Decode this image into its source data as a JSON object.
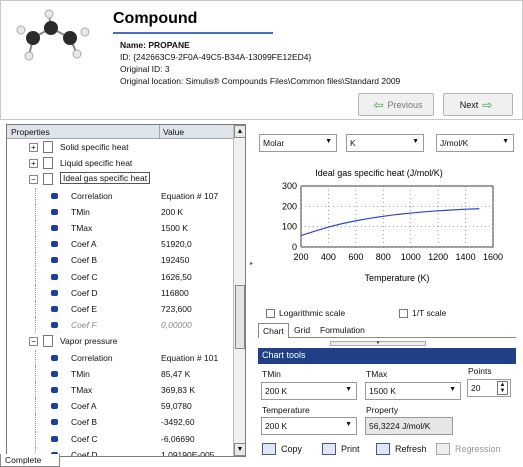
{
  "header": {
    "title": "Compound",
    "name_line": "Name: PROPANE",
    "id_line": "ID: {242663C9-2F0A-49C5-B34A-13099FE12ED4}",
    "original_id_line": "Original ID: 3",
    "location_line": "Original location: Simulis® Compounds Files\\Common files\\Standard 2009",
    "previous_label": "Previous",
    "next_label": "Next"
  },
  "tree": {
    "col_properties": "Properties",
    "col_value": "Value",
    "rows": [
      {
        "label": "Solid specific heat",
        "value": "",
        "kind": "group",
        "expanded": false
      },
      {
        "label": "Liquid specific heat",
        "value": "",
        "kind": "group",
        "expanded": false
      },
      {
        "label": "Ideal gas specific heat",
        "value": "",
        "kind": "group",
        "expanded": true,
        "highlight": true
      },
      {
        "label": "Correlation",
        "value": "Equation # 107",
        "kind": "leaf"
      },
      {
        "label": "TMin",
        "value": "200 K",
        "kind": "leaf"
      },
      {
        "label": "TMax",
        "value": "1500 K",
        "kind": "leaf"
      },
      {
        "label": "Coef A",
        "value": "51920,0",
        "kind": "leaf"
      },
      {
        "label": "Coef B",
        "value": "192450",
        "kind": "leaf"
      },
      {
        "label": "Coef C",
        "value": "1626,50",
        "kind": "leaf"
      },
      {
        "label": "Coef D",
        "value": "116800",
        "kind": "leaf"
      },
      {
        "label": "Coef E",
        "value": "723,600",
        "kind": "leaf"
      },
      {
        "label": "Coef F",
        "value": "0,00000",
        "kind": "leaf",
        "muted": true
      },
      {
        "label": "Vapor pressure",
        "value": "",
        "kind": "group",
        "expanded": true
      },
      {
        "label": "Correlation",
        "value": "Equation # 101",
        "kind": "leaf"
      },
      {
        "label": "TMin",
        "value": "85,47 K",
        "kind": "leaf"
      },
      {
        "label": "TMax",
        "value": "369,83 K",
        "kind": "leaf"
      },
      {
        "label": "Coef A",
        "value": "59,0780",
        "kind": "leaf"
      },
      {
        "label": "Coef B",
        "value": "-3492,60",
        "kind": "leaf"
      },
      {
        "label": "Coef C",
        "value": "-6,06690",
        "kind": "leaf"
      },
      {
        "label": "Coef D",
        "value": "1,09190E-005",
        "kind": "leaf"
      }
    ]
  },
  "status_tab": "Complete",
  "units": {
    "basis": "Molar",
    "temperature": "K",
    "cp": "J/mol/K"
  },
  "chart_data": {
    "type": "line",
    "title": "Ideal gas specific heat (J/mol/K)",
    "xlabel": "Temperature (K)",
    "ylabel": "",
    "xlim": [
      200,
      1600
    ],
    "ylim": [
      0,
      300
    ],
    "xticks": [
      200,
      400,
      600,
      800,
      1000,
      1200,
      1400,
      1600
    ],
    "yticks": [
      0,
      100,
      200,
      300
    ],
    "grid": true,
    "series": [
      {
        "x": [
          200,
          300,
          400,
          500,
          600,
          700,
          800,
          900,
          1000,
          1100,
          1200,
          1300,
          1400,
          1500
        ],
        "y": [
          56,
          78,
          98,
          115,
          129,
          141,
          151,
          160,
          167,
          173,
          178,
          182,
          186,
          188
        ]
      }
    ]
  },
  "options": {
    "log_scale": "Logarithmic scale",
    "inv_t_scale": "1/T scale"
  },
  "tabs": [
    "Chart",
    "Grid",
    "Formulation"
  ],
  "chart_tools": {
    "title": "Chart tools",
    "tmin_label": "TMin",
    "tmin_value": "200 K",
    "tmax_label": "TMax",
    "tmax_value": "1500 K",
    "points_label": "Points",
    "points_value": "20",
    "temperature_label": "Temperature",
    "temperature_value": "200 K",
    "property_label": "Property",
    "property_value": "56,3224 J/mol/K"
  },
  "actions": {
    "copy": "Copy",
    "print": "Print",
    "refresh": "Refresh",
    "regression": "Regression"
  }
}
